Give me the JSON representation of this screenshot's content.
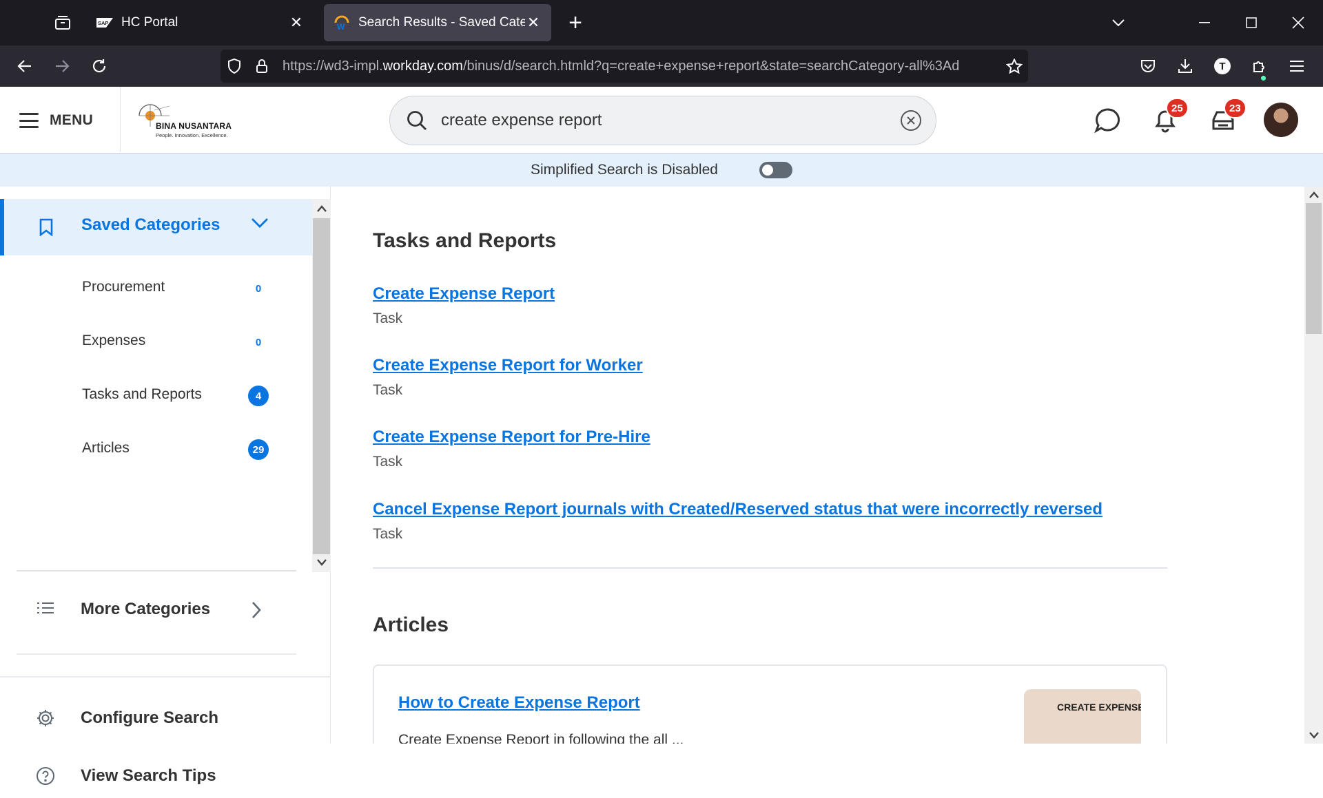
{
  "browser": {
    "tabs": [
      {
        "title": "HC Portal",
        "favicon": "sap-logo"
      },
      {
        "title": "Search Results - Saved Categories",
        "favicon": "workday-logo",
        "active": true
      }
    ],
    "url": {
      "prefix": "https://wd3-impl.",
      "host": "workday.com",
      "path": "/binus/d/search.htmld?q=create+expense+report&state=searchCategory-all%3Ad"
    },
    "account_initial": "T"
  },
  "header": {
    "menu_label": "MENU",
    "logo": {
      "name": "BINA NUSANTARA",
      "tagline": "People.  Innovation.  Excellence."
    },
    "search_query": "create expense report",
    "notifications_count": "25",
    "inbox_count": "23"
  },
  "banner": {
    "text": "Simplified Search is Disabled",
    "toggle_on": false
  },
  "sidebar": {
    "saved_categories_label": "Saved Categories",
    "categories": [
      {
        "label": "Procurement",
        "count": "0"
      },
      {
        "label": "Expenses",
        "count": "0"
      },
      {
        "label": "Tasks and Reports",
        "count": "4"
      },
      {
        "label": "Articles",
        "count": "29"
      }
    ],
    "more_categories_label": "More Categories",
    "configure_search_label": "Configure Search",
    "view_search_tips_label": "View Search Tips"
  },
  "main": {
    "tasks_section_title": "Tasks and Reports",
    "results": [
      {
        "title": "Create Expense Report",
        "type": "Task"
      },
      {
        "title": "Create Expense Report for Worker",
        "type": "Task"
      },
      {
        "title": "Create Expense Report for Pre-Hire",
        "type": "Task"
      },
      {
        "title": "Cancel Expense Report journals with Created/Reserved status that were incorrectly reversed",
        "type": "Task"
      }
    ],
    "articles_section_title": "Articles",
    "article": {
      "title": "How to Create Expense Report",
      "snippet": "Create Expense Report in following the all  ...",
      "thumbnail_text": "CREATE EXPENSE"
    }
  },
  "colors": {
    "accent": "#0875e1",
    "badge_red": "#de2e21",
    "banner_bg": "#e4f0fb"
  }
}
